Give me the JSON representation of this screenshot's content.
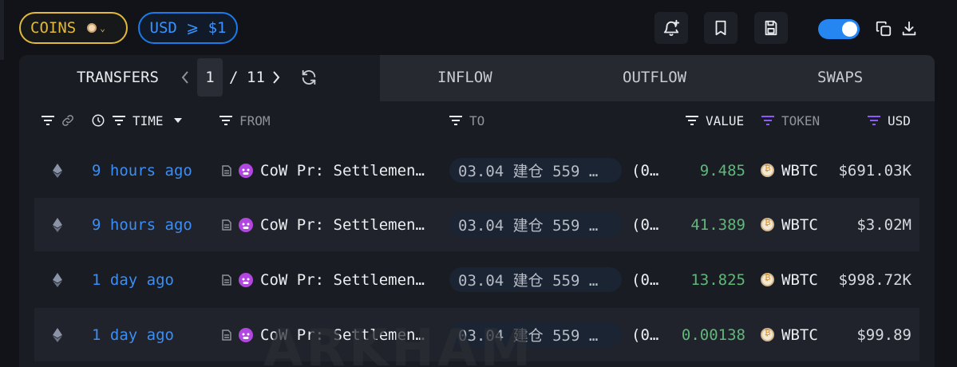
{
  "toolbar": {
    "coins_label": "COINS",
    "usd_filter_label": "USD ⩾ $1",
    "icons": [
      "bell-plus-icon",
      "bookmark-icon",
      "save-icon",
      "toggle",
      "copy-icon",
      "download-icon"
    ],
    "toggle_on": true
  },
  "tabs": {
    "transfers": "TRANSFERS",
    "page_current": "1",
    "page_sep": "/",
    "page_total": "11",
    "inflow": "INFLOW",
    "outflow": "OUTFLOW",
    "swaps": "SWAPS"
  },
  "columns": {
    "time": "TIME",
    "from": "FROM",
    "to": "TO",
    "value": "VALUE",
    "token": "TOKEN",
    "usd": "USD"
  },
  "rows": [
    {
      "time": "9 hours ago",
      "from": "CoW Pr: Settlemen…",
      "to": "03.04 建仓 559 …",
      "to_extra": "(0…",
      "value": "9.485",
      "token": "WBTC",
      "usd": "$691.03K"
    },
    {
      "time": "9 hours ago",
      "from": "CoW Pr: Settlemen…",
      "to": "03.04 建仓 559 …",
      "to_extra": "(0…",
      "value": "41.389",
      "token": "WBTC",
      "usd": "$3.02M"
    },
    {
      "time": "1 day ago",
      "from": "CoW Pr: Settlemen…",
      "to": "03.04 建仓 559 …",
      "to_extra": "(0…",
      "value": "13.825",
      "token": "WBTC",
      "usd": "$998.72K"
    },
    {
      "time": "1 day ago",
      "from": "CoW Pr: Settlemen…",
      "to": "03.04 建仓 559 …",
      "to_extra": "(0…",
      "value": "0.00138",
      "token": "WBTC",
      "usd": "$99.89"
    }
  ],
  "watermark": "ARKHAM",
  "colors": {
    "accent_blue": "#2585f1",
    "coins_gold": "#e2b93b",
    "value_green": "#5fb87a",
    "token_purple": "#8b5cf6"
  }
}
